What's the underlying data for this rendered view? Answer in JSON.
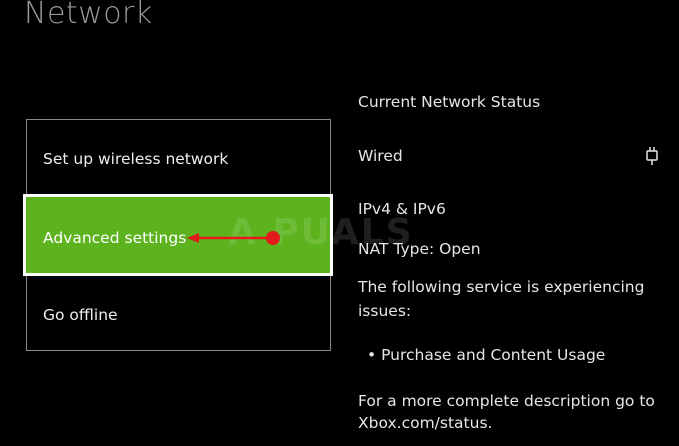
{
  "page": {
    "title": "Network"
  },
  "menu": {
    "items": [
      {
        "label": "Set up wireless network"
      },
      {
        "label": "Advanced settings",
        "selected": true
      },
      {
        "label": "Go offline"
      }
    ]
  },
  "status": {
    "heading": "Current Network Status",
    "connection": "Wired",
    "connection_icon": "ethernet-plug-icon",
    "ip": "IPv4 & IPv6",
    "nat": "NAT Type: Open",
    "issue_line1": "The following service is experiencing",
    "issue_line2": "issues:",
    "bullet": "• Purchase and Content Usage",
    "desc_line1": "For a more complete description go to",
    "desc_line2": "Xbox.com/status."
  },
  "watermark": {
    "text": "A  PUALS"
  },
  "colors": {
    "background": "#000000",
    "selected": "#5cb31e",
    "annotation_arrow": "#e21b1b",
    "text": "#e6e6e6",
    "title": "#9a9a9a"
  }
}
